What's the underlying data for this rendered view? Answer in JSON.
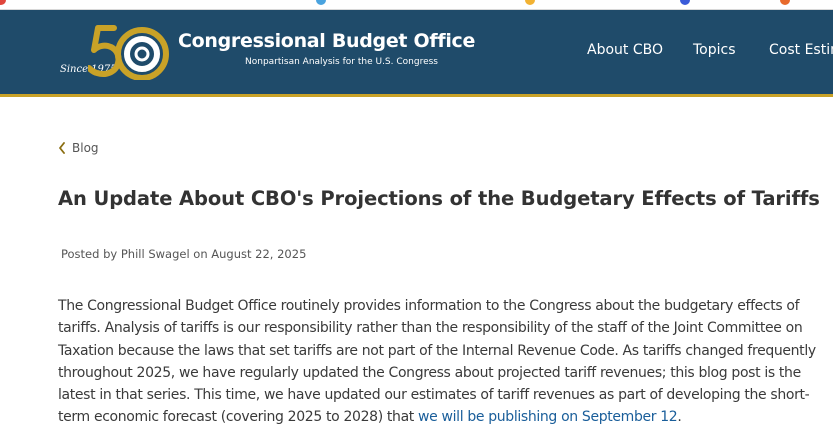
{
  "colors": {
    "header_bg": "#1f4b6a",
    "accent_gold": "#c9a227",
    "link_blue": "#1a5e9a",
    "title_text": "#333333",
    "body_text": "#3a3a3a"
  },
  "header": {
    "logo_badge": "Since 1975",
    "org_name": "Congressional Budget Office",
    "tagline": "Nonpartisan Analysis for the U.S. Congress",
    "logo_icon": "cbo-50-anniversary-logo"
  },
  "nav": {
    "items": [
      {
        "label": "About CBO"
      },
      {
        "label": "Topics"
      },
      {
        "label": "Cost Estimates"
      }
    ]
  },
  "breadcrumb": {
    "label": "Blog",
    "icon": "chevron-left-icon"
  },
  "post": {
    "title": "An Update About CBO's Projections of the Budgetary Effects of Tariffs",
    "byline": "Posted by Phill Swagel on August 22, 2025",
    "body_lines": [
      "The Congressional Budget Office routinely provides information to the Congress about the budgetary effects of",
      "tariffs. Analysis of tariffs is our responsibility rather than the responsibility of the staff of the Joint Committee on",
      "Taxation because the laws that set tariffs are not part of the Internal Revenue Code. As tariffs changed frequently",
      "throughout 2025, we have regularly updated the Congress about projected tariff revenues; this blog post is the",
      "latest in that series. This time, we have updated our estimates of tariff revenues as part of developing the short-"
    ],
    "last_line_prefix": "term economic forecast (covering 2025 to 2028) that ",
    "last_line_link": "we will be publishing on September 12",
    "last_line_suffix": "."
  }
}
